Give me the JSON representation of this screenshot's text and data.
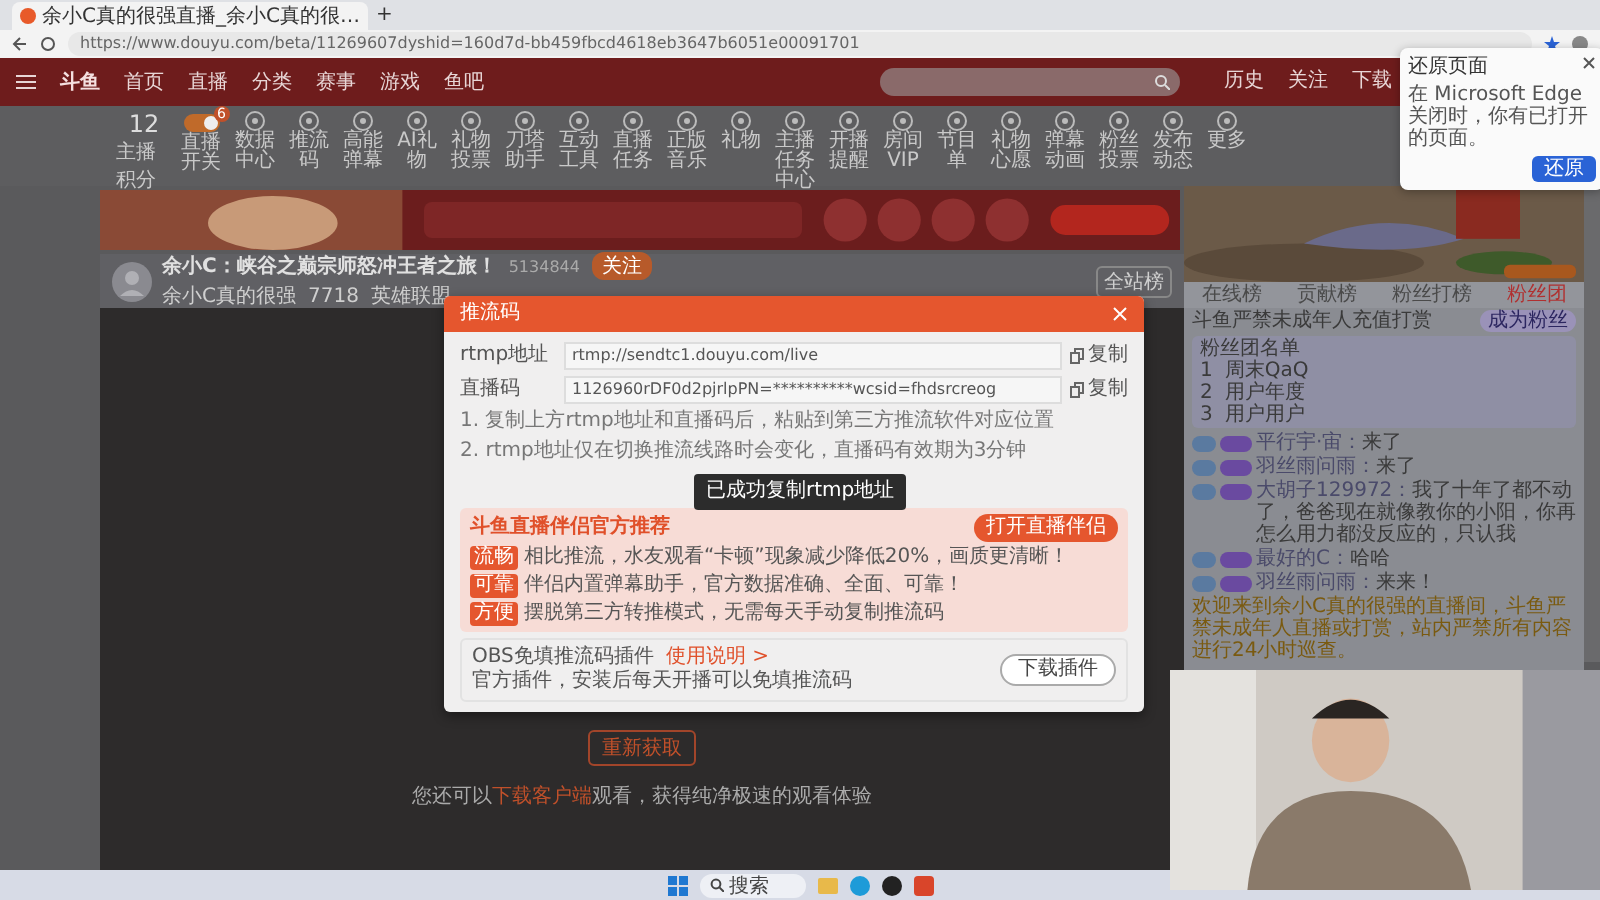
{
  "browser": {
    "tab_title": "余小C真的很强直播_余小C真的很…",
    "new_tab": "+",
    "url": "https://www.douyu.com/beta/11269607dyshid=160d7d-bb459fbcd4618eb3647b6051e00091701"
  },
  "site_nav": {
    "logo": "斗鱼",
    "links": [
      {
        "label": "首页",
        "selected": false
      },
      {
        "label": "直播",
        "selected": false
      },
      {
        "label": "分类",
        "selected": false
      },
      {
        "label": "赛事",
        "selected": false
      },
      {
        "label": "游戏",
        "selected": false
      },
      {
        "label": "鱼吧",
        "selected": false
      }
    ],
    "actions": [
      "历史",
      "关注",
      "下载"
    ]
  },
  "restore_popup": {
    "title": "还原页面",
    "message": "在 Microsoft Edge 关闭时，你有已打开的页面。",
    "button": "还原"
  },
  "toolbar": {
    "score": "12",
    "score_label": "主播积分",
    "tools": [
      {
        "label": "直播开关",
        "kind": "toggle",
        "on": true,
        "badge": "6"
      },
      {
        "label": "数据中心",
        "kind": "tool"
      },
      {
        "label": "推流码",
        "kind": "tool"
      },
      {
        "label": "高能弹幕",
        "kind": "tool"
      },
      {
        "label": "AI礼物",
        "kind": "tool"
      },
      {
        "label": "礼物投票",
        "kind": "tool"
      },
      {
        "label": "刀塔助手",
        "kind": "tool"
      },
      {
        "label": "互动工具",
        "kind": "tool"
      },
      {
        "label": "直播任务",
        "kind": "tool"
      },
      {
        "label": "正版音乐",
        "kind": "tool"
      },
      {
        "label": "礼物",
        "kind": "tool"
      },
      {
        "label": "主播任务中心",
        "kind": "tool"
      },
      {
        "label": "开播提醒",
        "kind": "tool"
      },
      {
        "label": "房间VIP",
        "kind": "tool"
      },
      {
        "label": "节目单",
        "kind": "tool"
      },
      {
        "label": "礼物心愿",
        "kind": "tool"
      },
      {
        "label": "弹幕动画",
        "kind": "tool"
      },
      {
        "label": "粉丝投票",
        "kind": "tool"
      },
      {
        "label": "发布动态",
        "kind": "tool"
      },
      {
        "label": "更多",
        "kind": "tool"
      }
    ]
  },
  "stream": {
    "title": "余小C：峡谷之巅宗师怒冲王者之旅！",
    "room_id": "5134844",
    "follow": "关注",
    "streamer": "余小C真的很强",
    "viewers": "7718",
    "category": "英雄联盟",
    "rank": "全站榜"
  },
  "push_modal": {
    "title": "推流码",
    "fields": [
      {
        "label": "rtmp地址",
        "value": "rtmp://sendtc1.douyu.com/live",
        "copy": "复制"
      },
      {
        "label": "直播码",
        "value": "1126960rDF0d2pjrlpPN=**********wcsid=fhdsrcreog",
        "copy": "复制"
      }
    ],
    "notes": [
      "1. 复制上方rtmp地址和直播码后，粘贴到第三方推流软件对应位置",
      "2. rtmp地址仅在切换推流线路时会变化，直播码有效期为3分钟"
    ],
    "toast": "已成功复制rtmp地址",
    "promo": {
      "title": "斗鱼直播伴侣官方推荐",
      "button": "打开直播伴侣",
      "points": [
        {
          "tag": "流畅",
          "text": "相比推流，水友观看“卡顿”现象减少降低20%，画质更清晰！"
        },
        {
          "tag": "可靠",
          "text": "伴侣内置弹幕助手，官方数据准确、全面、可靠！"
        },
        {
          "tag": "方便",
          "text": "摆脱第三方转推模式，无需每天手动复制推流码"
        }
      ]
    },
    "plugin": {
      "title": "OBS免填推流码插件",
      "link": "使用说明 >",
      "text": "官方插件，安装后每天开播可以免填推流码",
      "button": "下载插件"
    }
  },
  "video_area": {
    "button": "重新获取",
    "hint_before": "您还可以",
    "hint_link": "下载客户端",
    "hint_after": "观看，获得纯净极速的观看体验"
  },
  "chat": {
    "tabs": [
      {
        "label": "在线榜",
        "selected": false
      },
      {
        "label": "贡献榜",
        "selected": false
      },
      {
        "label": "粉丝打榜",
        "selected": false
      },
      {
        "label": "粉丝团",
        "selected": true
      }
    ],
    "notice": "斗鱼严禁未成年人充值打赏",
    "join": "成为粉丝",
    "fan_header": "粉丝团名单",
    "fans": [
      {
        "rank": "1",
        "name": "周末QaQ"
      },
      {
        "rank": "2",
        "name": "用户年度"
      },
      {
        "rank": "3",
        "name": "用户用户"
      }
    ],
    "messages": [
      {
        "kind": "user",
        "user": "平行宇·宙：",
        "text": "来了"
      },
      {
        "kind": "user",
        "user": "羽丝雨问雨：",
        "text": "来了"
      },
      {
        "kind": "user",
        "user": "大胡子129972：",
        "text": "我了十年了都不动了，爸爸现在就像教你的小阳，你再怎么用力都没反应的，只认我"
      },
      {
        "kind": "user",
        "user": "最好的C：",
        "text": "哈哈"
      },
      {
        "kind": "user",
        "user": "羽丝雨问雨：",
        "text": "来来！"
      },
      {
        "kind": "system",
        "text": "欢迎来到余小C真的很强的直播间，斗鱼严禁未成年人直播或打赏，站内严禁所有内容进行24小时巡查。"
      }
    ]
  },
  "taskbar": {
    "search": "搜索"
  }
}
